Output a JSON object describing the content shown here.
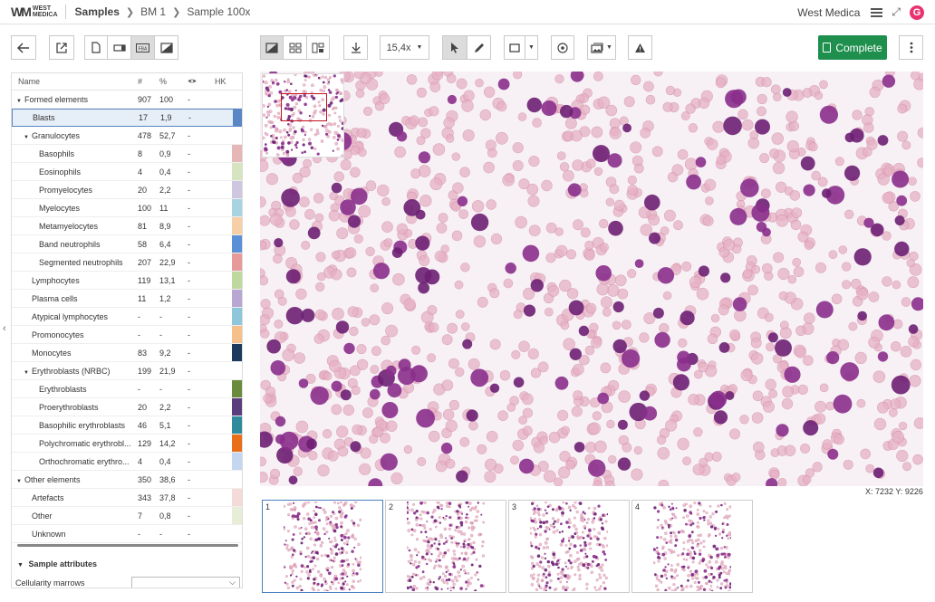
{
  "header": {
    "logo_mark": "WM",
    "logo_line1": "WEST",
    "logo_line2": "MEDICA",
    "breadcrumb": [
      "Samples",
      "BM 1",
      "Sample 100x"
    ],
    "org": "West Medica",
    "avatar_letter": "G"
  },
  "toolbar": {
    "zoom": "15,4x",
    "complete_label": "Complete",
    "mode_labels": [
      "FBA"
    ]
  },
  "table": {
    "headers": [
      "Name",
      "#",
      "%",
      "",
      "HK"
    ],
    "rows": [
      {
        "name": "Formed elements",
        "count": "907",
        "pct": "100",
        "vis": "-",
        "level": 0,
        "expand": true
      },
      {
        "name": "Blasts",
        "count": "17",
        "pct": "1,9",
        "vis": "-",
        "level": 1,
        "color": "#5b86c6",
        "selected": true
      },
      {
        "name": "Granulocytes",
        "count": "478",
        "pct": "52,7",
        "vis": "-",
        "level": 1,
        "expand": true
      },
      {
        "name": "Basophils",
        "count": "8",
        "pct": "0,9",
        "vis": "-",
        "level": 2,
        "color": "#e7b6b6"
      },
      {
        "name": "Eosinophils",
        "count": "4",
        "pct": "0,4",
        "vis": "-",
        "level": 2,
        "color": "#d6e4c0"
      },
      {
        "name": "Promyelocytes",
        "count": "20",
        "pct": "2,2",
        "vis": "-",
        "level": 2,
        "color": "#cfc6e0"
      },
      {
        "name": "Myelocytes",
        "count": "100",
        "pct": "11",
        "vis": "-",
        "level": 2,
        "color": "#a8d4e2"
      },
      {
        "name": "Metamyelocytes",
        "count": "81",
        "pct": "8,9",
        "vis": "-",
        "level": 2,
        "color": "#f7cfa7"
      },
      {
        "name": "Band neutrophils",
        "count": "58",
        "pct": "6,4",
        "vis": "-",
        "level": 2,
        "color": "#5b8fd6"
      },
      {
        "name": "Segmented neutrophils",
        "count": "207",
        "pct": "22,9",
        "vis": "-",
        "level": 2,
        "color": "#e69a9a"
      },
      {
        "name": "Lymphocytes",
        "count": "119",
        "pct": "13,1",
        "vis": "-",
        "level": 1,
        "color": "#bfd89e"
      },
      {
        "name": "Plasma cells",
        "count": "11",
        "pct": "1,2",
        "vis": "-",
        "level": 1,
        "color": "#b7a7d2"
      },
      {
        "name": "Atypical lymphocytes",
        "count": "-",
        "pct": "-",
        "vis": "-",
        "level": 1,
        "color": "#8fc6dc"
      },
      {
        "name": "Promonocytes",
        "count": "-",
        "pct": "-",
        "vis": "-",
        "level": 1,
        "color": "#f6c08a"
      },
      {
        "name": "Monocytes",
        "count": "83",
        "pct": "9,2",
        "vis": "-",
        "level": 1,
        "color": "#1b3a5e"
      },
      {
        "name": "Erythroblasts (NRBC)",
        "count": "199",
        "pct": "21,9",
        "vis": "-",
        "level": 1,
        "expand": true
      },
      {
        "name": "Erythroblasts",
        "count": "-",
        "pct": "-",
        "vis": "-",
        "level": 2,
        "color": "#6b8b3c"
      },
      {
        "name": "Proerythroblasts",
        "count": "20",
        "pct": "2,2",
        "vis": "-",
        "level": 2,
        "color": "#5a3d7d"
      },
      {
        "name": "Basophilic erythroblasts",
        "count": "46",
        "pct": "5,1",
        "vis": "-",
        "level": 2,
        "color": "#2f8a9e"
      },
      {
        "name": "Polychromatic erythrobl...",
        "count": "129",
        "pct": "14,2",
        "vis": "-",
        "level": 2,
        "color": "#e86e1a"
      },
      {
        "name": "Orthochromatic erythro...",
        "count": "4",
        "pct": "0,4",
        "vis": "-",
        "level": 2,
        "color": "#c4d6f0"
      },
      {
        "name": "Other elements",
        "count": "350",
        "pct": "38,6",
        "vis": "-",
        "level": 0,
        "expand": true
      },
      {
        "name": "Artefacts",
        "count": "343",
        "pct": "37,8",
        "vis": "-",
        "level": 1,
        "color": "#f5dada"
      },
      {
        "name": "Other",
        "count": "7",
        "pct": "0,8",
        "vis": "-",
        "level": 1,
        "color": "#e8edd8"
      },
      {
        "name": "Unknown",
        "count": "-",
        "pct": "-",
        "vis": "-",
        "level": 1,
        "color": "#ffffff"
      }
    ]
  },
  "attributes": {
    "title": "Sample attributes",
    "cellularity_label": "Cellularity marrows",
    "cellularity_value": ""
  },
  "viewer": {
    "coords": "X: 7232  Y: 9226"
  },
  "thumbnails": [
    {
      "index": "1",
      "active": true
    },
    {
      "index": "2",
      "active": false
    },
    {
      "index": "3",
      "active": false
    },
    {
      "index": "4",
      "active": false
    }
  ]
}
